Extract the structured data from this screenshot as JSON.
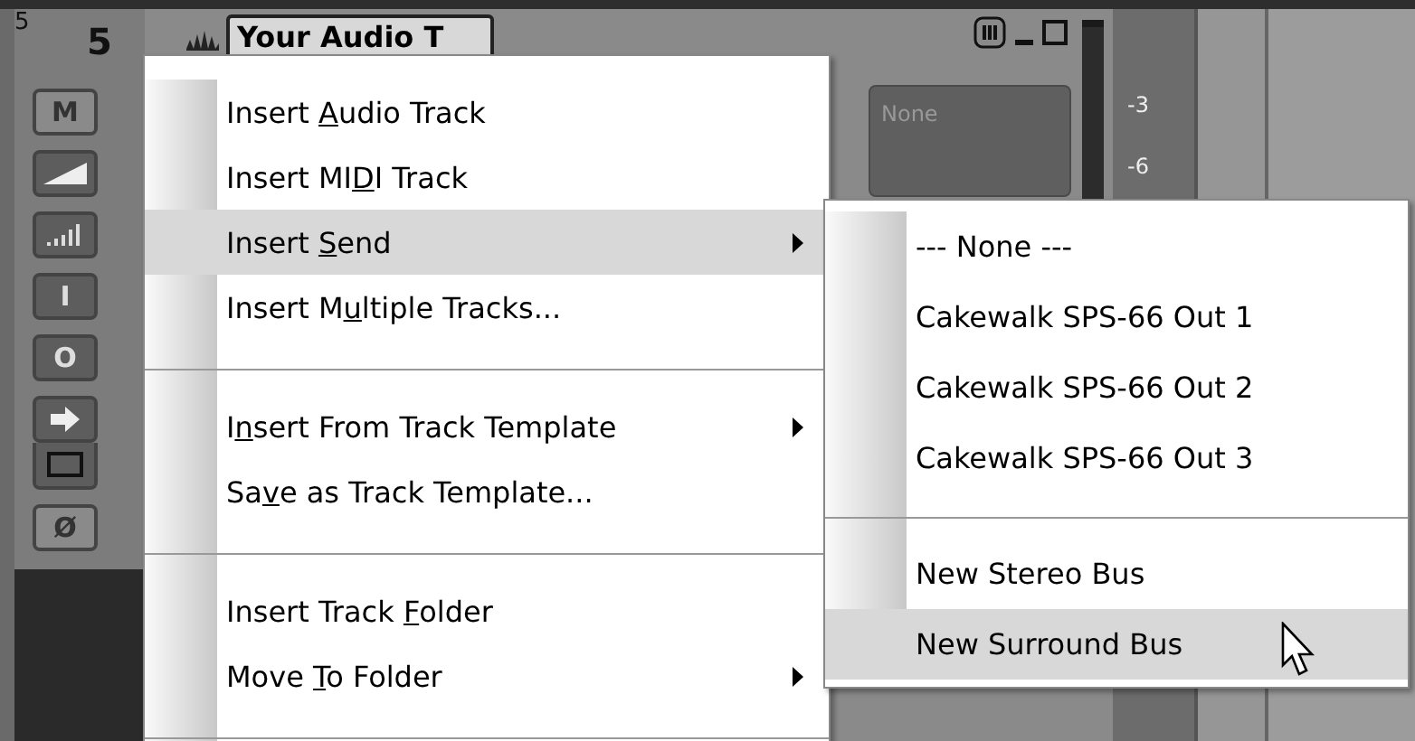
{
  "track": {
    "number_small": "5",
    "number": "5",
    "title": "Your Audio T",
    "buttons": [
      {
        "kind": "text",
        "label": "M"
      },
      {
        "kind": "volume"
      },
      {
        "kind": "bars"
      },
      {
        "kind": "text",
        "label": "I"
      },
      {
        "kind": "text",
        "label": "O"
      },
      {
        "kind": "arrow"
      },
      {
        "kind": "square"
      },
      {
        "kind": "text",
        "label": "Ø"
      }
    ],
    "send_field": "None",
    "meter_scale": [
      "-3",
      "-6"
    ]
  },
  "menu": {
    "items": [
      {
        "kind": "item",
        "before": "Insert ",
        "key": "A",
        "after": "udio Track",
        "submenu": false,
        "selected": false
      },
      {
        "kind": "item",
        "before": "Insert MI",
        "key": "D",
        "after": "I Track",
        "submenu": false,
        "selected": false
      },
      {
        "kind": "item",
        "before": "Insert ",
        "key": "S",
        "after": "end",
        "submenu": true,
        "selected": true
      },
      {
        "kind": "item",
        "before": "Insert M",
        "key": "u",
        "after": "ltiple Tracks...",
        "submenu": false,
        "selected": false
      },
      {
        "kind": "separator"
      },
      {
        "kind": "item",
        "before": "I",
        "key": "n",
        "after": "sert From Track Template",
        "submenu": true,
        "selected": false
      },
      {
        "kind": "item",
        "before": "Sa",
        "key": "v",
        "after": "e as Track Template...",
        "submenu": false,
        "selected": false
      },
      {
        "kind": "separator"
      },
      {
        "kind": "item",
        "before": "Insert Track ",
        "key": "F",
        "after": "older",
        "submenu": false,
        "selected": false
      },
      {
        "kind": "item",
        "before": "Move ",
        "key": "T",
        "after": "o Folder",
        "submenu": true,
        "selected": false
      },
      {
        "kind": "separator"
      }
    ]
  },
  "submenu": {
    "items": [
      {
        "kind": "item",
        "label": "--- None ---",
        "selected": false
      },
      {
        "kind": "item",
        "label": "Cakewalk SPS-66 Out 1",
        "selected": false
      },
      {
        "kind": "item",
        "label": "Cakewalk SPS-66 Out 2",
        "selected": false
      },
      {
        "kind": "item",
        "label": "Cakewalk SPS-66 Out 3",
        "selected": false
      },
      {
        "kind": "separator"
      },
      {
        "kind": "item",
        "label": "New Stereo Bus",
        "selected": false
      },
      {
        "kind": "item",
        "label": "New Surround Bus",
        "selected": true
      }
    ]
  }
}
